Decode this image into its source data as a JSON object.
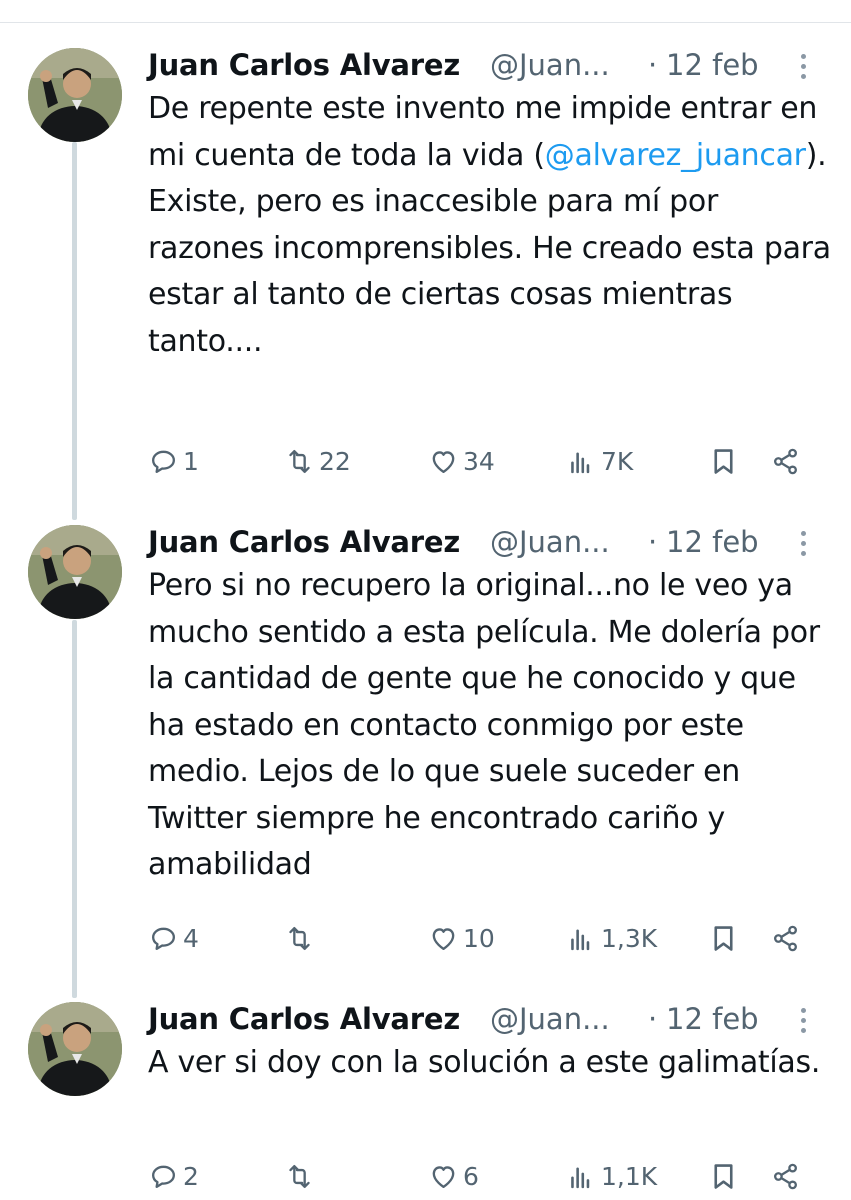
{
  "tweets": [
    {
      "author": "Juan Carlos Alvarez",
      "handle": "@Juan...",
      "separator": "·",
      "date": "12 feb",
      "text_before": "De repente este invento me impide entrar en mi cuenta de toda la vida (",
      "mention": "@alvarez_juancar",
      "text_after": "). Existe, pero es inaccesible para mí por razones incomprensibles. He creado esta para estar al tanto de ciertas cosas mientras tanto....",
      "replies": "1",
      "retweets": "22",
      "likes": "34",
      "views": "7K"
    },
    {
      "author": "Juan Carlos Alvarez",
      "handle": "@Juan...",
      "separator": "·",
      "date": "12 feb",
      "text_before": "Pero si no recupero la original...no le veo ya mucho sentido a esta película. Me dolería por la cantidad de gente que he conocido y que ha estado en contacto conmigo por este medio. Lejos de lo que suele suceder en Twitter siempre he encontrado cariño y amabilidad",
      "mention": "",
      "text_after": "",
      "replies": "4",
      "retweets": "",
      "likes": "10",
      "views": "1,3K"
    },
    {
      "author": "Juan Carlos Alvarez",
      "handle": "@Juan...",
      "separator": "·",
      "date": "12 feb",
      "text_before": "A ver si doy con la solución a este galimatías.",
      "mention": "",
      "text_after": "",
      "replies": "2",
      "retweets": "",
      "likes": "6",
      "views": "1,1K"
    }
  ],
  "icons": {
    "reply": "reply-icon",
    "retweet": "retweet-icon",
    "like": "heart-icon",
    "views": "views-icon",
    "bookmark": "bookmark-icon",
    "share": "share-icon",
    "more": "more-icon"
  },
  "colors": {
    "text": "#0f1419",
    "secondary": "#536471",
    "link": "#1d9bf0",
    "thread_line": "#cfd9de"
  }
}
